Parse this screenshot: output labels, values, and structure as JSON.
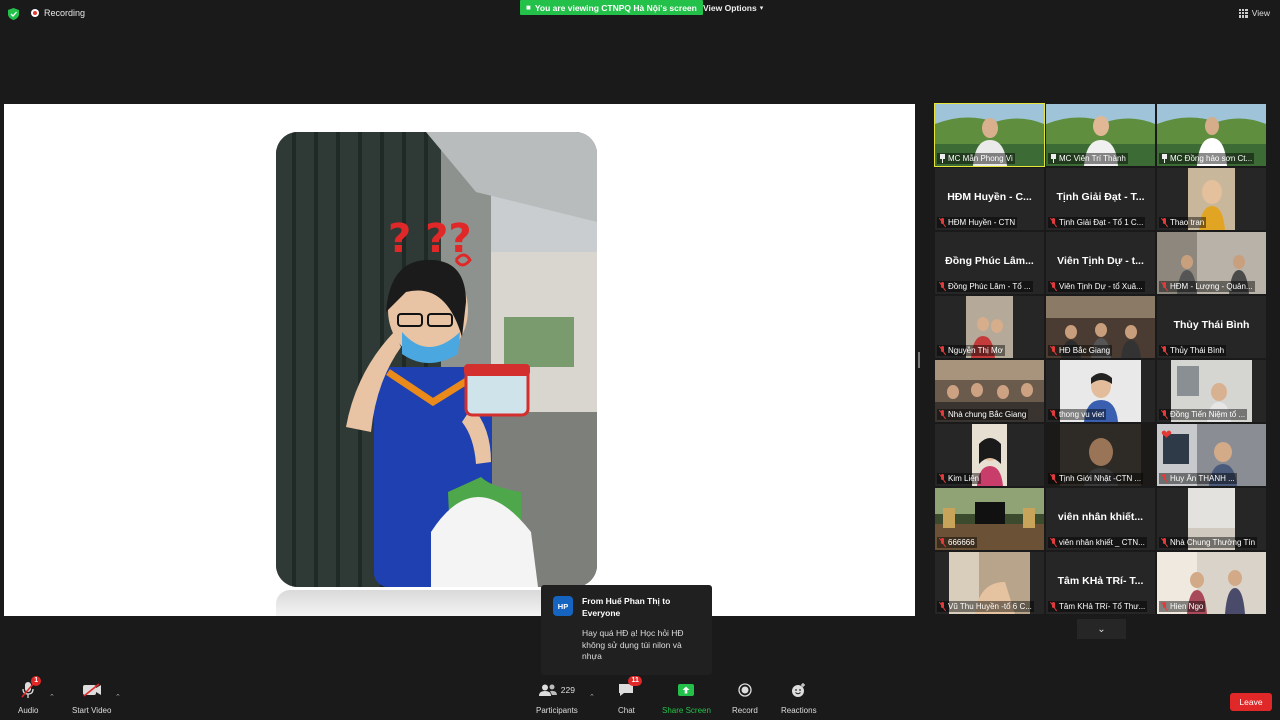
{
  "topbar": {
    "recording_label": "Recording",
    "viewing_banner": "You are viewing CTNPQ Hà Nội's screen",
    "view_options_label": "View Options",
    "view_label": "View"
  },
  "chat_toast": {
    "avatar_initials": "HP",
    "from": "From Huế Phan Thị to Everyone",
    "message": "Hay quá HĐ ạ! Học hỏi HĐ không sử dụng túi nilon và nhựa"
  },
  "participants": [
    {
      "name": "MC Mẫn Phong Vi",
      "display": "",
      "kind": "video",
      "pinned": true,
      "active": true
    },
    {
      "name": "MC Viên Trí Thành",
      "display": "",
      "kind": "video",
      "pinned": true
    },
    {
      "name": "MC Đồng hảo sơn Ct...",
      "display": "",
      "kind": "video",
      "pinned": true
    },
    {
      "name": "HĐM Huyền - CTN",
      "display": "HĐM Huyền - C...",
      "kind": "name"
    },
    {
      "name": "Tịnh Giải Đạt - Tổ 1 C...",
      "display": "Tịnh Giải Đạt - T...",
      "kind": "name"
    },
    {
      "name": "Thao tran",
      "display": "",
      "kind": "video"
    },
    {
      "name": "Đồng Phúc Lâm - Tổ ...",
      "display": "Đồng Phúc Lâm...",
      "kind": "name"
    },
    {
      "name": "Viên Tịnh Dự - tổ Xuâ...",
      "display": "Viên Tịnh Dự - t...",
      "kind": "name"
    },
    {
      "name": "HĐM - Lượng - Quản...",
      "display": "",
      "kind": "video"
    },
    {
      "name": "Nguyễn Thị Mơ",
      "display": "",
      "kind": "video"
    },
    {
      "name": "HĐ Bắc Giang",
      "display": "",
      "kind": "video"
    },
    {
      "name": "Thủy Thái Bình",
      "display": "Thủy Thái Bình",
      "kind": "name"
    },
    {
      "name": "Nhà chung Bắc Giang",
      "display": "",
      "kind": "video"
    },
    {
      "name": "thong vu viet",
      "display": "",
      "kind": "video"
    },
    {
      "name": "Đồng Tiến Niệm tổ ...",
      "display": "",
      "kind": "video"
    },
    {
      "name": "Kim Liên",
      "display": "",
      "kind": "video"
    },
    {
      "name": "Tịnh Giới Nhật -CTN ...",
      "display": "",
      "kind": "video"
    },
    {
      "name": "Huy Ân THANH ...",
      "display": "",
      "kind": "video",
      "reaction": "heart"
    },
    {
      "name": "666666",
      "display": "",
      "kind": "video"
    },
    {
      "name": "viên nhân khiết _ CTN...",
      "display": "viên nhân khiết...",
      "kind": "name"
    },
    {
      "name": "Nhà Chung Thường Tín",
      "display": "",
      "kind": "video"
    },
    {
      "name": "Vũ Thu Huyền -tổ 6 C...",
      "display": "",
      "kind": "video"
    },
    {
      "name": "Tâm KHả TRí- Tổ Thư...",
      "display": "Tâm KHả TRí- T...",
      "kind": "name"
    },
    {
      "name": "Hien Ngo",
      "display": "",
      "kind": "video"
    }
  ],
  "toolbar": {
    "audio_label": "Audio",
    "audio_badge": "1",
    "video_label": "Start Video",
    "participants_label": "Participants",
    "participants_count": "229",
    "chat_label": "Chat",
    "chat_badge": "11",
    "share_label": "Share Screen",
    "record_label": "Record",
    "reactions_label": "Reactions",
    "leave_label": "Leave"
  },
  "colors": {
    "background": "#1a1a1a",
    "share_green": "#23c14a",
    "leave_red": "#e02828",
    "active_speaker": "#e5e53a"
  }
}
